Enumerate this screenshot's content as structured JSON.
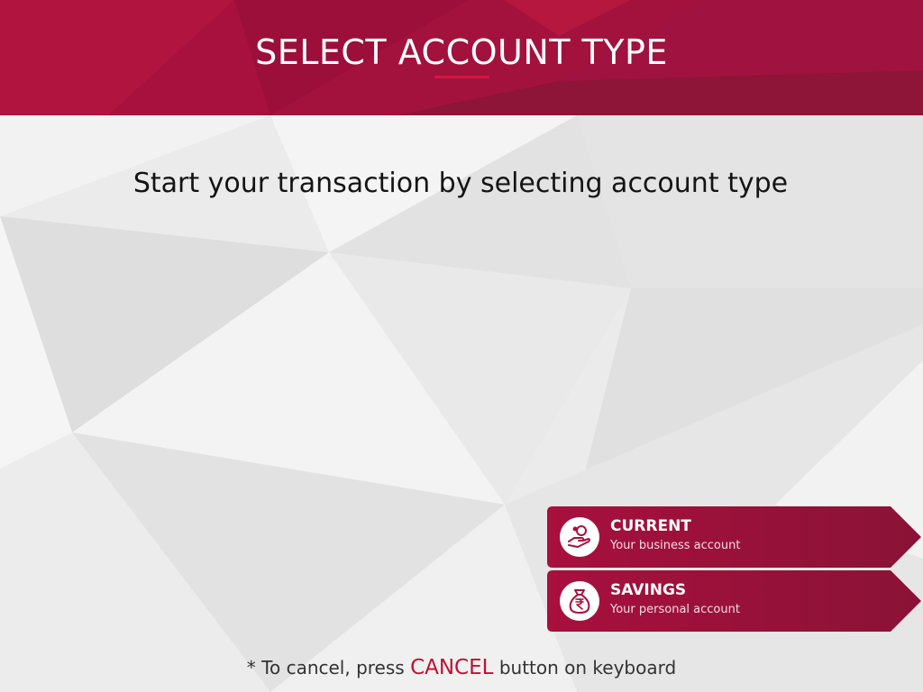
{
  "header": {
    "title": "SELECT ACCOUNT TYPE"
  },
  "instruction": "Start your transaction by selecting account type",
  "accounts": [
    {
      "title": "CURRENT",
      "subtitle": "Your business account",
      "icon": "hand-coin-icon"
    },
    {
      "title": "SAVINGS",
      "subtitle": "Your personal account",
      "icon": "rupee-money-bag-icon"
    }
  ],
  "footer": {
    "prefix": "* To cancel, press",
    "key": "CANCEL",
    "suffix": "button on keyboard"
  },
  "colors": {
    "brand": "#a8103e",
    "brand_dark": "#8a1236",
    "accent": "#c01030",
    "background": "#ececec"
  }
}
